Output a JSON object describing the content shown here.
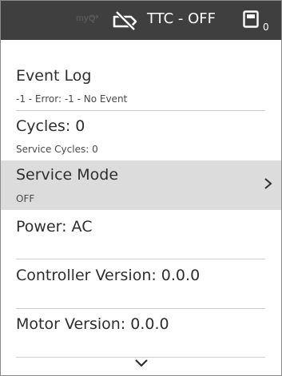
{
  "status_bar": {
    "myq_label": "myQ",
    "myq_arrow": "→",
    "lid_icon": "lid-disconnected-icon",
    "ttc_status": "TTC - OFF",
    "bin_icon": "waste-drawer-icon",
    "bin_count": "0"
  },
  "menu": {
    "event_log": {
      "title": "Event Log",
      "subtitle": "-1 - Error: -1 - No Event"
    },
    "cycles": {
      "title": "Cycles: 0",
      "subtitle": "Service Cycles: 0"
    },
    "service_mode": {
      "title": "Service Mode",
      "subtitle": "OFF"
    },
    "power": {
      "title": "Power: AC"
    },
    "controller_version": {
      "title": "Controller Version: 0.0.0"
    },
    "motor_version": {
      "title": "Motor Version: 0.0.0"
    }
  },
  "icons": {
    "chevron_right": "chevron-right-icon",
    "chevron_down": "chevron-down-icon"
  },
  "colors": {
    "status_bar_bg": "#3f3f3f",
    "selected_row_bg": "#dcdcdc",
    "text": "#2e2e2e"
  }
}
